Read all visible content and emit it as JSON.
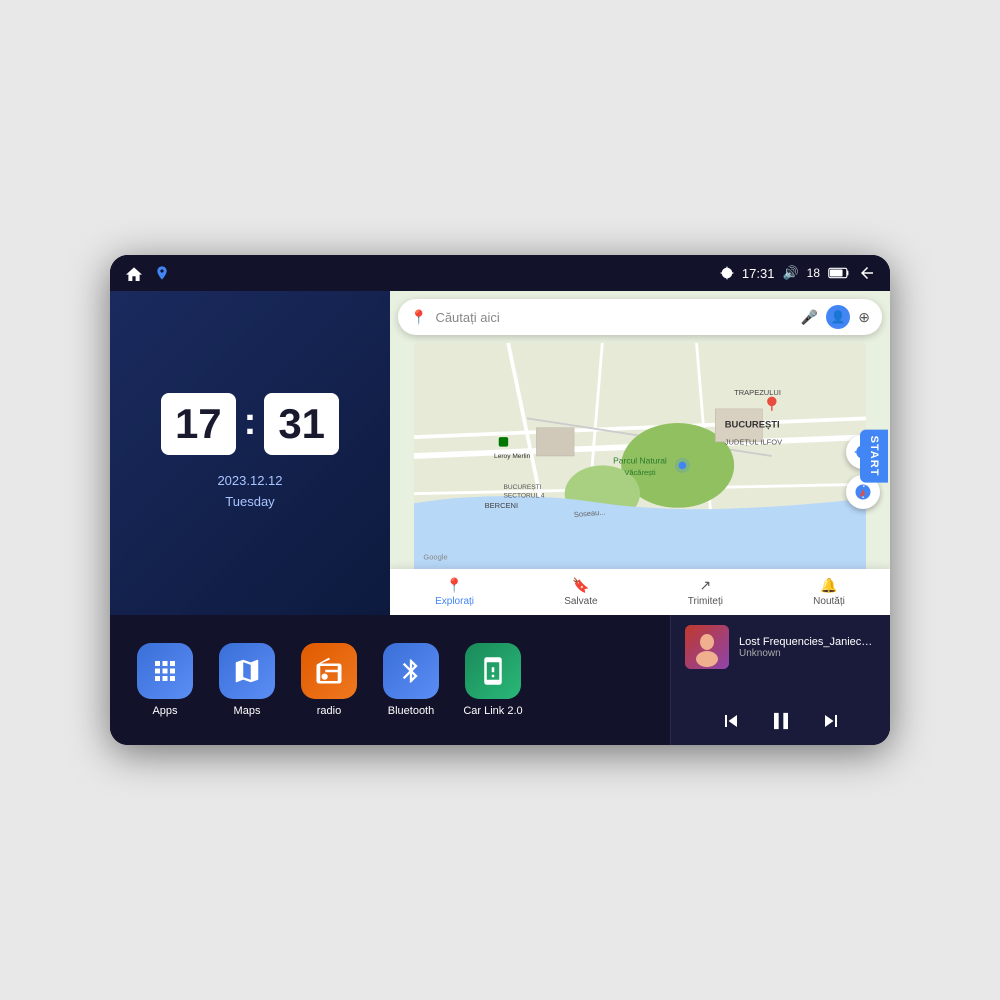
{
  "device": {
    "status_bar": {
      "left_icons": [
        "home",
        "map-pin"
      ],
      "time": "17:31",
      "volume_icon": "🔊",
      "battery_level": "18",
      "battery_icon": "🔋",
      "back_icon": "↩"
    }
  },
  "clock_widget": {
    "hour": "17",
    "minute": "31",
    "date": "2023.12.12",
    "day": "Tuesday"
  },
  "map_widget": {
    "search_placeholder": "Căutați aici",
    "nav_items": [
      {
        "label": "Explorați",
        "active": true
      },
      {
        "label": "Salvate",
        "active": false
      },
      {
        "label": "Trimiteți",
        "active": false
      },
      {
        "label": "Noutăți",
        "active": false
      }
    ],
    "location_labels": [
      "BUCUREȘTI",
      "JUDEȚUL ILFOV",
      "TRAPEZULUI",
      "BERCENI",
      "BUCUREȘTI SECTORUL 4"
    ],
    "parks": [
      "Parcul Natural Văcărești"
    ],
    "stores": [
      "Leroy Merlin"
    ],
    "start_btn": "START"
  },
  "app_icons": [
    {
      "id": "apps",
      "label": "Apps",
      "icon_class": "icon-apps",
      "symbol": "⊞"
    },
    {
      "id": "maps",
      "label": "Maps",
      "icon_class": "icon-maps",
      "symbol": "📍"
    },
    {
      "id": "radio",
      "label": "radio",
      "icon_class": "icon-radio",
      "symbol": "📻"
    },
    {
      "id": "bluetooth",
      "label": "Bluetooth",
      "icon_class": "icon-bluetooth",
      "symbol": "⚡"
    },
    {
      "id": "carlink",
      "label": "Car Link 2.0",
      "icon_class": "icon-carlink",
      "symbol": "📱"
    }
  ],
  "music_player": {
    "title": "Lost Frequencies_Janieck Devy-...",
    "artist": "Unknown",
    "controls": {
      "prev": "⏮",
      "play": "⏸",
      "next": "⏭"
    }
  }
}
